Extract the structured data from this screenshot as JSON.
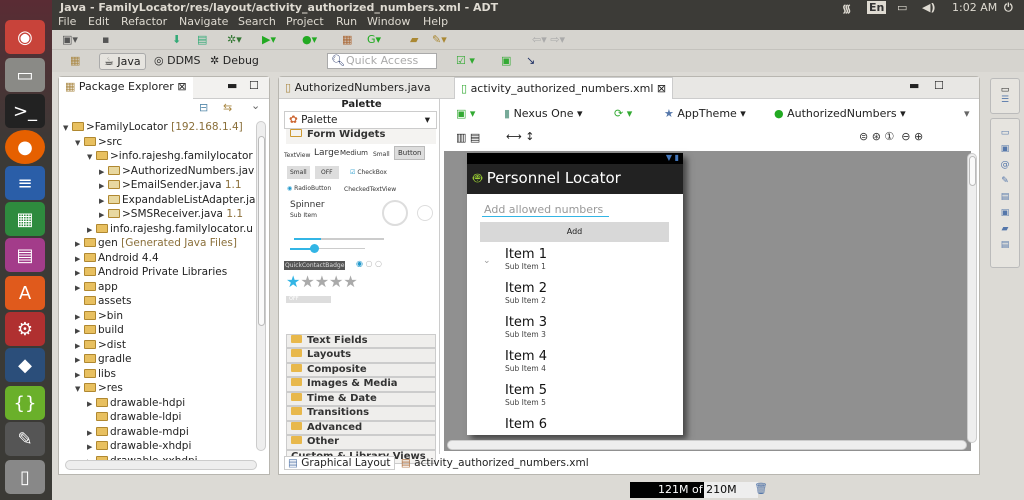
{
  "window": {
    "title": "Java - FamilyLocator/res/layout/activity_authorized_numbers.xml - ADT"
  },
  "tray": {
    "keyboard": "En",
    "time": "1:02 AM"
  },
  "menu": [
    "File",
    "Edit",
    "Refactor",
    "Navigate",
    "Search",
    "Project",
    "Run",
    "Window",
    "Help"
  ],
  "perspectives": {
    "java": "Java",
    "ddms": "DDMS",
    "debug": "Debug"
  },
  "quick_access": {
    "placeholder": "Quick Access"
  },
  "package_explorer": {
    "title": "Package Explorer",
    "tree": [
      {
        "label": ">FamilyLocator",
        "extra": "[192.168.1.4]",
        "level": 0,
        "arrow": "▼"
      },
      {
        "label": ">src",
        "level": 1,
        "arrow": "▼"
      },
      {
        "label": ">info.rajeshg.familylocator",
        "level": 2,
        "arrow": "▼"
      },
      {
        "label": ">AuthorizedNumbers.java",
        "level": 3,
        "arrow": "▶"
      },
      {
        "label": ">EmailSender.java",
        "extra": "1.1",
        "level": 3,
        "arrow": "▶"
      },
      {
        "label": "ExpandableListAdapter.ja",
        "level": 3,
        "arrow": "▶"
      },
      {
        "label": ">SMSReceiver.java",
        "extra": "1.1",
        "level": 3,
        "arrow": "▶"
      },
      {
        "label": "info.rajeshg.familylocator.u",
        "level": 2,
        "arrow": "▶"
      },
      {
        "label": "gen",
        "extra": "[Generated Java Files]",
        "level": 1,
        "arrow": "▶"
      },
      {
        "label": "Android 4.4",
        "level": 1,
        "arrow": "▶"
      },
      {
        "label": "Android Private Libraries",
        "level": 1,
        "arrow": "▶"
      },
      {
        "label": "app",
        "level": 1,
        "arrow": "▶"
      },
      {
        "label": "assets",
        "level": 1,
        "arrow": ""
      },
      {
        "label": ">bin",
        "level": 1,
        "arrow": "▶"
      },
      {
        "label": "build",
        "level": 1,
        "arrow": "▶"
      },
      {
        "label": ">dist",
        "level": 1,
        "arrow": "▶"
      },
      {
        "label": "gradle",
        "level": 1,
        "arrow": "▶"
      },
      {
        "label": "libs",
        "level": 1,
        "arrow": "▶"
      },
      {
        "label": ">res",
        "level": 1,
        "arrow": "▼"
      },
      {
        "label": "drawable-hdpi",
        "level": 2,
        "arrow": "▶"
      },
      {
        "label": "drawable-ldpi",
        "level": 2,
        "arrow": ""
      },
      {
        "label": "drawable-mdpi",
        "level": 2,
        "arrow": "▶"
      },
      {
        "label": "drawable-xhdpi",
        "level": 2,
        "arrow": "▶"
      },
      {
        "label": "drawable-xxhdpi",
        "level": 2,
        "arrow": "▶"
      }
    ]
  },
  "editor": {
    "tabs": [
      "AuthorizedNumbers.java",
      "activity_authorized_numbers.xml"
    ],
    "device": "Nexus One",
    "theme": "AppTheme",
    "activity": "AuthorizedNumbers",
    "bottom_tabs": [
      "Graphical Layout",
      "activity_authorized_numbers.xml"
    ]
  },
  "palette": {
    "header": "Palette",
    "dropdown": "Palette",
    "open_category": "Form Widgets",
    "widgets": {
      "textview": "TextView",
      "large": "Large",
      "medium": "Medium",
      "small": "Small",
      "button": "Button",
      "small_btn": "Small",
      "off": "OFF",
      "checkbox": "CheckBox",
      "radio": "RadioButton",
      "checked": "CheckedTextView",
      "spinner": "Spinner",
      "sub_item": "Sub Item",
      "badge": "QuickContactBadge",
      "switch_off": "OFF"
    },
    "categories": [
      "Text Fields",
      "Layouts",
      "Composite",
      "Images & Media",
      "Time & Date",
      "Transitions",
      "Advanced",
      "Other"
    ],
    "custom": "Custom & Library Views"
  },
  "app": {
    "title": "Personnel Locator",
    "input_placeholder": "Add allowed numbers",
    "add_button": "Add",
    "items": [
      {
        "title": "Item 1",
        "sub": "Sub Item 1"
      },
      {
        "title": "Item 2",
        "sub": "Sub Item 2"
      },
      {
        "title": "Item 3",
        "sub": "Sub Item 3"
      },
      {
        "title": "Item 4",
        "sub": "Sub Item 4"
      },
      {
        "title": "Item 5",
        "sub": "Sub Item 5"
      },
      {
        "title": "Item 6",
        "sub": ""
      }
    ]
  },
  "status": {
    "memory": "121M of 210M",
    "memory_used_fraction": 0.58
  },
  "colors": {
    "accent": "#33b5e5",
    "titlebar": "#3c3b37",
    "ubuntu": "#dd4814"
  }
}
